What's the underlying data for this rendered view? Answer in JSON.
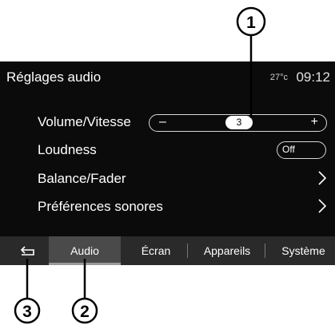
{
  "header": {
    "title": "Réglages audio",
    "temperature": "27°c",
    "time": "09:12"
  },
  "rows": [
    {
      "label": "Volume/Vitesse",
      "control": "slider",
      "minus": "–",
      "plus": "+",
      "value": "3"
    },
    {
      "label": "Loudness",
      "control": "toggle",
      "value": "Off"
    },
    {
      "label": "Balance/Fader",
      "control": "chevron"
    },
    {
      "label": "Préférences sonores",
      "control": "chevron"
    }
  ],
  "tabs": {
    "back_icon": "back-arrow-icon",
    "items": [
      "Audio",
      "Écran",
      "Appareils",
      "Système"
    ],
    "active": "Audio"
  },
  "callouts": [
    "1",
    "2",
    "3"
  ],
  "colors": {
    "screen_bg": "#0b0b0b",
    "tabbar_bg": "#2a2a2a",
    "active_tab_bg": "#4a4a4a",
    "text": "#ffffff"
  }
}
